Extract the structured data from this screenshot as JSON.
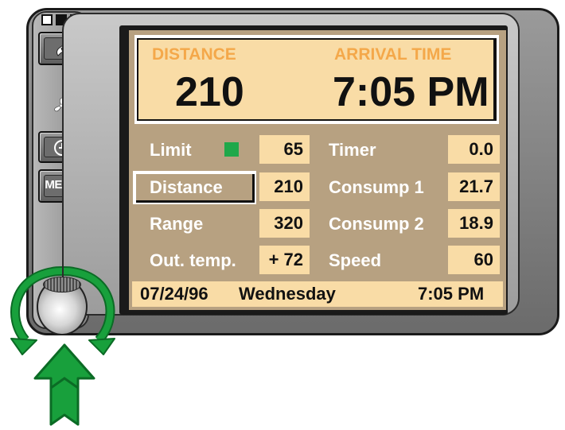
{
  "header": {
    "distance_label": "DISTANCE",
    "arrival_label": "ARRIVAL TIME",
    "distance_value": "210",
    "arrival_value": "7:05 PM"
  },
  "left_rows": [
    {
      "label": "Limit",
      "value": "65"
    },
    {
      "label": "Distance",
      "value": "210"
    },
    {
      "label": "Range",
      "value": "320"
    },
    {
      "label": "Out. temp.",
      "value": "+ 72"
    }
  ],
  "right_rows": [
    {
      "label": "Timer",
      "value": "0.0"
    },
    {
      "label": "Consump 1",
      "value": "21.7"
    },
    {
      "label": "Consump 2",
      "value": "18.9"
    },
    {
      "label": "Speed",
      "value": "60"
    }
  ],
  "status": {
    "date": "07/24/96",
    "day": "Wednesday",
    "time": "7:05 PM"
  },
  "buttons": {
    "menu_label": "MENU"
  },
  "icons": {
    "phone": "phone-icon",
    "fan": "fan-icon",
    "clock": "clock-icon",
    "limit_indicator": "green-square-indicator",
    "rotate_arrows": "rotate-arrows-icon",
    "push_arrow": "push-arrow-icon"
  },
  "colors": {
    "screen_bg": "#b7a181",
    "value_bg": "#f9dca6",
    "header_label": "#f4a84a",
    "indicator_green": "#1fa84a",
    "arrow_green": "#18a03c"
  }
}
